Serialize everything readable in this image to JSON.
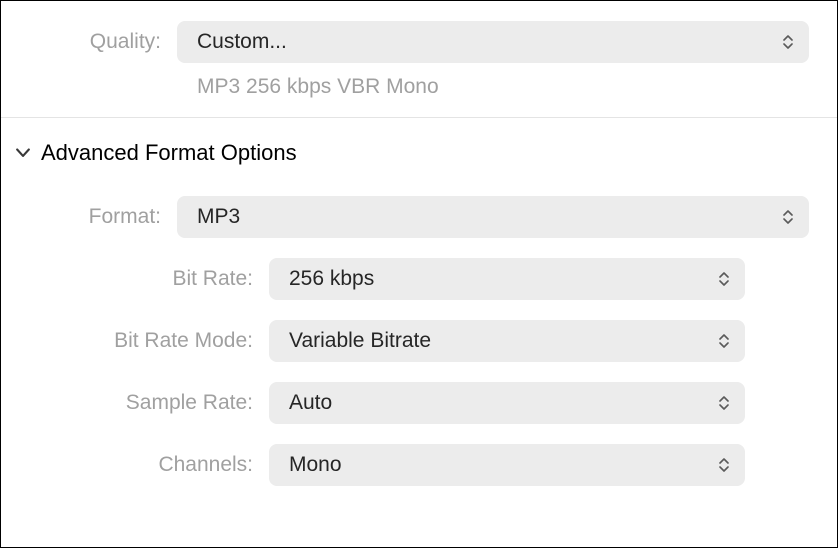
{
  "quality": {
    "label": "Quality:",
    "value": "Custom...",
    "summary": "MP3 256 kbps VBR Mono"
  },
  "advanced": {
    "title": "Advanced Format Options",
    "format": {
      "label": "Format:",
      "value": "MP3"
    },
    "bitrate": {
      "label": "Bit Rate:",
      "value": "256 kbps"
    },
    "bitrate_mode": {
      "label": "Bit Rate Mode:",
      "value": "Variable Bitrate"
    },
    "sample_rate": {
      "label": "Sample Rate:",
      "value": "Auto"
    },
    "channels": {
      "label": "Channels:",
      "value": "Mono"
    }
  }
}
